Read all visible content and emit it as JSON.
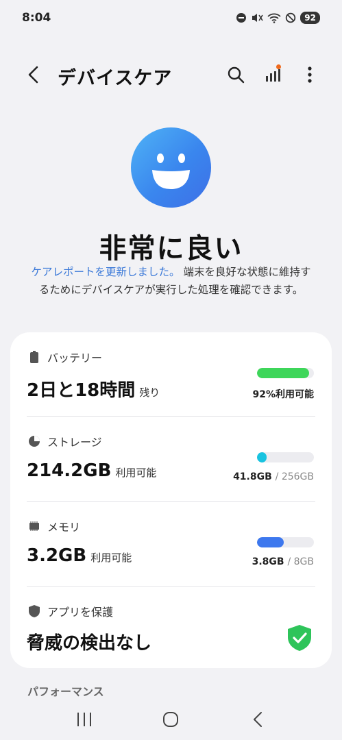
{
  "status_bar": {
    "time": "8:04",
    "battery": "92",
    "icons": [
      "dnd-icon",
      "mute-icon",
      "wifi-icon",
      "blocked-icon",
      "battery-icon"
    ]
  },
  "app_bar": {
    "title": "デバイスケア",
    "icons": [
      "back-arrow-icon",
      "search-icon",
      "signal-bars-icon",
      "more-vertical-icon"
    ]
  },
  "hero": {
    "status": "非常に良い",
    "link_text": "ケアレポートを更新しました。",
    "description": " 端末を良好な状態に維持するためにデバイスケアが実行した処理を確認できます。",
    "accent_color": "#3a86ee"
  },
  "card": {
    "battery": {
      "label": "バッテリー",
      "value": "2日と18時間",
      "unit": "残り",
      "percent": 92,
      "meta": "92%利用可能",
      "color": "#3ed65a"
    },
    "storage": {
      "label": "ストレージ",
      "value": "214.2GB",
      "unit": "利用可能",
      "used": "41.8GB",
      "total": "/ 256GB",
      "fraction": 0.163,
      "color": "#19c3e0"
    },
    "memory": {
      "label": "メモリ",
      "value": "3.2GB",
      "unit": "利用可能",
      "used": "3.8GB",
      "total": "/ 8GB",
      "fraction": 0.475,
      "color": "#3d78ee"
    },
    "protection": {
      "label": "アプリを保護",
      "value": "脅威の検出なし",
      "color": "#2ec45a"
    }
  },
  "section": {
    "performance": "パフォーマンス"
  },
  "nav_bar": {
    "icons": [
      "recents-icon",
      "home-icon",
      "back-icon"
    ]
  }
}
